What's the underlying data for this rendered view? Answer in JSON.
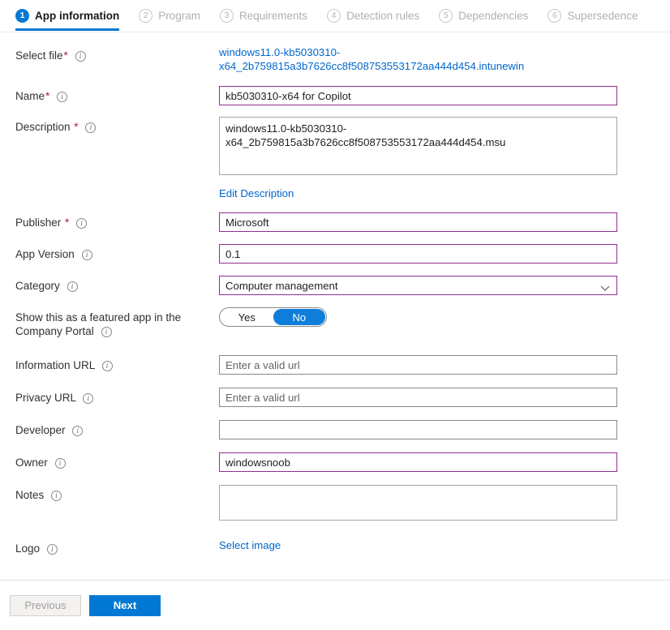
{
  "wizard": {
    "tabs": [
      {
        "number": "1",
        "label": "App information",
        "active": true
      },
      {
        "number": "2",
        "label": "Program",
        "active": false
      },
      {
        "number": "3",
        "label": "Requirements",
        "active": false
      },
      {
        "number": "4",
        "label": "Detection rules",
        "active": false
      },
      {
        "number": "5",
        "label": "Dependencies",
        "active": false
      },
      {
        "number": "6",
        "label": "Supersedence",
        "active": false
      }
    ]
  },
  "form": {
    "select_file": {
      "label": "Select file",
      "required": "*",
      "file_name": "windows11.0-kb5030310-x64_2b759815a3b7626cc8f508753553172aa444d454.intunewin"
    },
    "name": {
      "label": "Name",
      "required": "*",
      "value": "kb5030310-x64 for Copilot"
    },
    "description": {
      "label": "Description",
      "required": "*",
      "value": "windows11.0-kb5030310-x64_2b759815a3b7626cc8f508753553172aa444d454.msu",
      "edit_link": "Edit Description"
    },
    "publisher": {
      "label": "Publisher",
      "required": "*",
      "value": "Microsoft"
    },
    "app_version": {
      "label": "App Version",
      "value": "0.1"
    },
    "category": {
      "label": "Category",
      "value": "Computer management"
    },
    "featured_app": {
      "label_line1": "Show this as a featured app in the",
      "label_line2": "Company Portal",
      "option_yes": "Yes",
      "option_no": "No",
      "selected": "No"
    },
    "information_url": {
      "label": "Information URL",
      "value": "",
      "placeholder": "Enter a valid url"
    },
    "privacy_url": {
      "label": "Privacy URL",
      "value": "",
      "placeholder": "Enter a valid url"
    },
    "developer": {
      "label": "Developer",
      "value": "",
      "placeholder": ""
    },
    "owner": {
      "label": "Owner",
      "value": "windowsnoob"
    },
    "notes": {
      "label": "Notes",
      "value": ""
    },
    "logo": {
      "label": "Logo",
      "select_image_link": "Select image"
    }
  },
  "footer": {
    "previous_label": "Previous",
    "next_label": "Next"
  },
  "colors": {
    "accent": "#0078d4",
    "filled_border": "#8f2f8f",
    "link": "#0066cc",
    "required": "#a4262c"
  }
}
